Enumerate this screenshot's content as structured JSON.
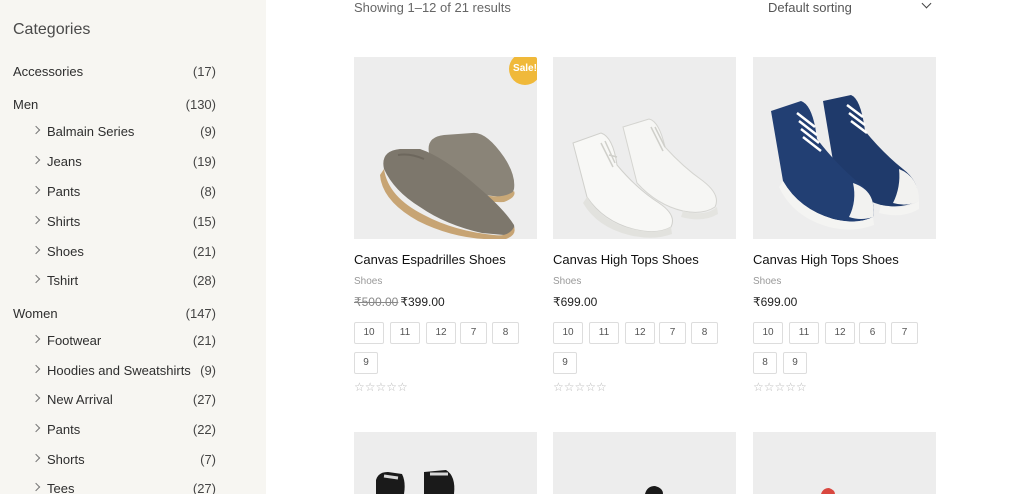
{
  "sidebar": {
    "title": "Categories",
    "items": [
      {
        "label": "Accessories",
        "count": "(17)",
        "level": "top"
      },
      {
        "label": "Men",
        "count": "(130)",
        "level": "top"
      },
      {
        "label": "Balmain Series",
        "count": "(9)",
        "level": "sub"
      },
      {
        "label": "Jeans",
        "count": "(19)",
        "level": "sub"
      },
      {
        "label": "Pants",
        "count": "(8)",
        "level": "sub"
      },
      {
        "label": "Shirts",
        "count": "(15)",
        "level": "sub"
      },
      {
        "label": "Shoes",
        "count": "(21)",
        "level": "sub"
      },
      {
        "label": "Tshirt",
        "count": "(28)",
        "level": "sub"
      },
      {
        "label": "Women",
        "count": "(147)",
        "level": "top"
      },
      {
        "label": "Footwear",
        "count": "(21)",
        "level": "sub"
      },
      {
        "label": "Hoodies and Sweatshirts",
        "count": "(9)",
        "level": "sub"
      },
      {
        "label": "New Arrival",
        "count": "(27)",
        "level": "sub"
      },
      {
        "label": "Pants",
        "count": "(22)",
        "level": "sub"
      },
      {
        "label": "Shorts",
        "count": "(7)",
        "level": "sub"
      },
      {
        "label": "Tees",
        "count": "(27)",
        "level": "sub"
      }
    ]
  },
  "toolbar": {
    "results": "Showing 1–12 of 21 results",
    "sorting": "Default sorting"
  },
  "products": [
    {
      "title": "Canvas Espadrilles Shoes",
      "category": "Shoes",
      "old_price": "₹500.00",
      "price": "₹399.00",
      "sale": "Sale!",
      "sizes": [
        "10",
        "11",
        "12",
        "7",
        "8",
        "9"
      ],
      "rating": "☆☆☆☆☆"
    },
    {
      "title": "Canvas High Tops Shoes",
      "category": "Shoes",
      "old_price": "",
      "price": "₹699.00",
      "sale": "",
      "sizes": [
        "10",
        "11",
        "12",
        "7",
        "8",
        "9"
      ],
      "rating": "☆☆☆☆☆"
    },
    {
      "title": "Canvas High Tops Shoes",
      "category": "Shoes",
      "old_price": "",
      "price": "₹699.00",
      "sale": "",
      "sizes": [
        "10",
        "11",
        "12",
        "6",
        "7",
        "8",
        "9"
      ],
      "rating": "☆☆☆☆☆"
    }
  ],
  "colors": {
    "sidebar_bg": "#f7f6f2",
    "sale_badge": "#f0b93a",
    "image_bg": "#ededed"
  }
}
